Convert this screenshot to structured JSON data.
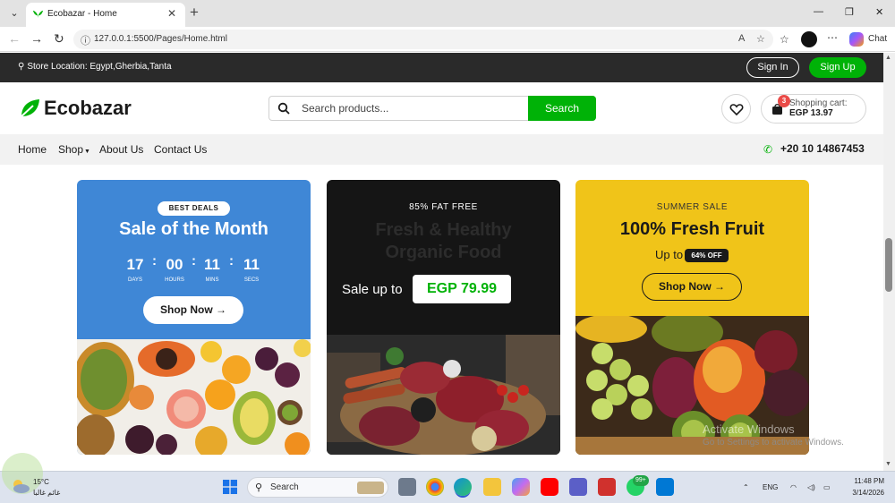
{
  "browser": {
    "tab_title": "Ecobazar - Home",
    "url": "127.0.0.1:5500/Pages/Home.html",
    "chat_label": "Chat"
  },
  "topbar": {
    "store_location": "Store Location: Egypt,Gherbia,Tanta",
    "sign_in": "Sign In",
    "sign_up": "Sign Up"
  },
  "header": {
    "logo": "Ecobazar",
    "search_placeholder": "Search products...",
    "search_button": "Search",
    "cart_count": "3",
    "cart_label": "Shopping cart:",
    "cart_total": "EGP 13.97"
  },
  "nav": {
    "items": [
      "Home",
      "Shop",
      "About Us",
      "Contact Us"
    ],
    "phone": "+20 10 14867453"
  },
  "cards": [
    {
      "tag": "BEST DEALS",
      "title": "Sale of the Month",
      "countdown": [
        {
          "value": "17",
          "unit": "DAYS"
        },
        {
          "value": "00",
          "unit": "HOURS"
        },
        {
          "value": "11",
          "unit": "MINS"
        },
        {
          "value": "11",
          "unit": "SECS"
        }
      ],
      "button": "Shop Now →"
    },
    {
      "tag": "85% FAT FREE",
      "title_line1": "Fresh & Healthy",
      "title_line2": "Organic Food",
      "sale_label": "Sale up to",
      "price": "EGP 79.99"
    },
    {
      "tag": "SUMMER SALE",
      "title": "100% Fresh Fruit",
      "up_to": "Up to",
      "discount": "64% OFF",
      "button": "Shop Now →"
    }
  ],
  "watermark": {
    "line1": "Activate Windows",
    "line2": "Go to Settings to activate Windows."
  },
  "taskbar": {
    "temp": "15°C",
    "condition": "غائم غالبا",
    "search": "Search",
    "whatsapp_badge": "99+",
    "lang": "ENG",
    "time": "11:48 PM",
    "date": "3/14/2026"
  },
  "colors": {
    "brand_green": "#00b207",
    "card1_bg": "#3f87d6",
    "card2_bg": "#151515",
    "card3_bg": "#f0c419"
  }
}
